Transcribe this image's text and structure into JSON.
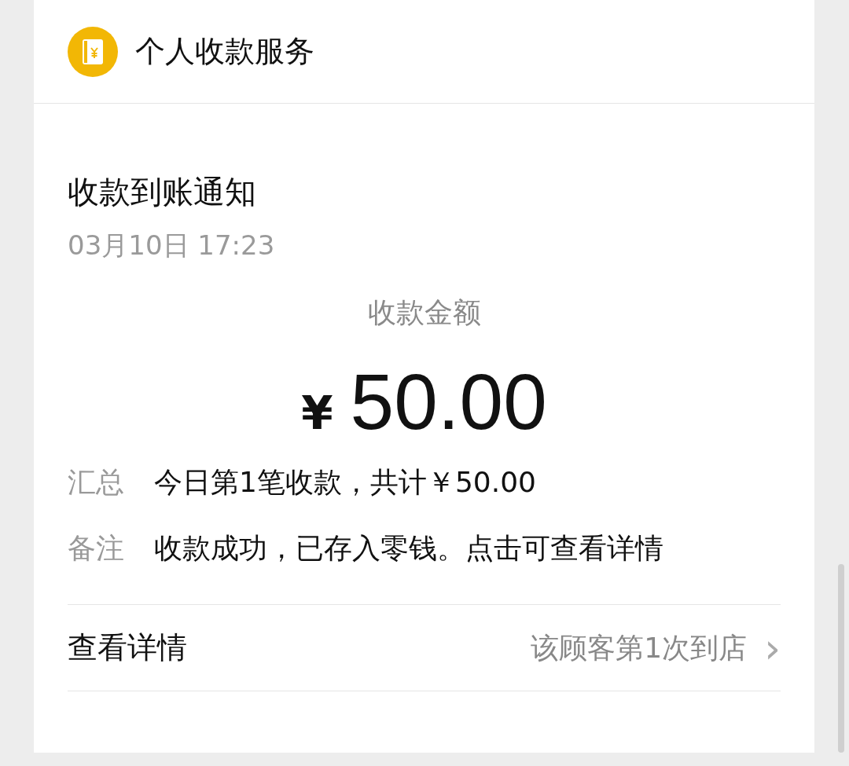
{
  "header": {
    "title": "个人收款服务"
  },
  "notice": {
    "title": "收款到账通知",
    "time": "03月10日 17:23",
    "amount_label": "收款金额",
    "currency": "¥",
    "amount": "50.00",
    "fields": [
      {
        "label": "汇总",
        "value": "今日第1笔收款，共计￥50.00"
      },
      {
        "label": "备注",
        "value": "收款成功，已存入零钱。点击可查看详情"
      }
    ]
  },
  "details_link": {
    "label": "查看详情",
    "note": "该顾客第1次到店",
    "chevron": "›"
  }
}
